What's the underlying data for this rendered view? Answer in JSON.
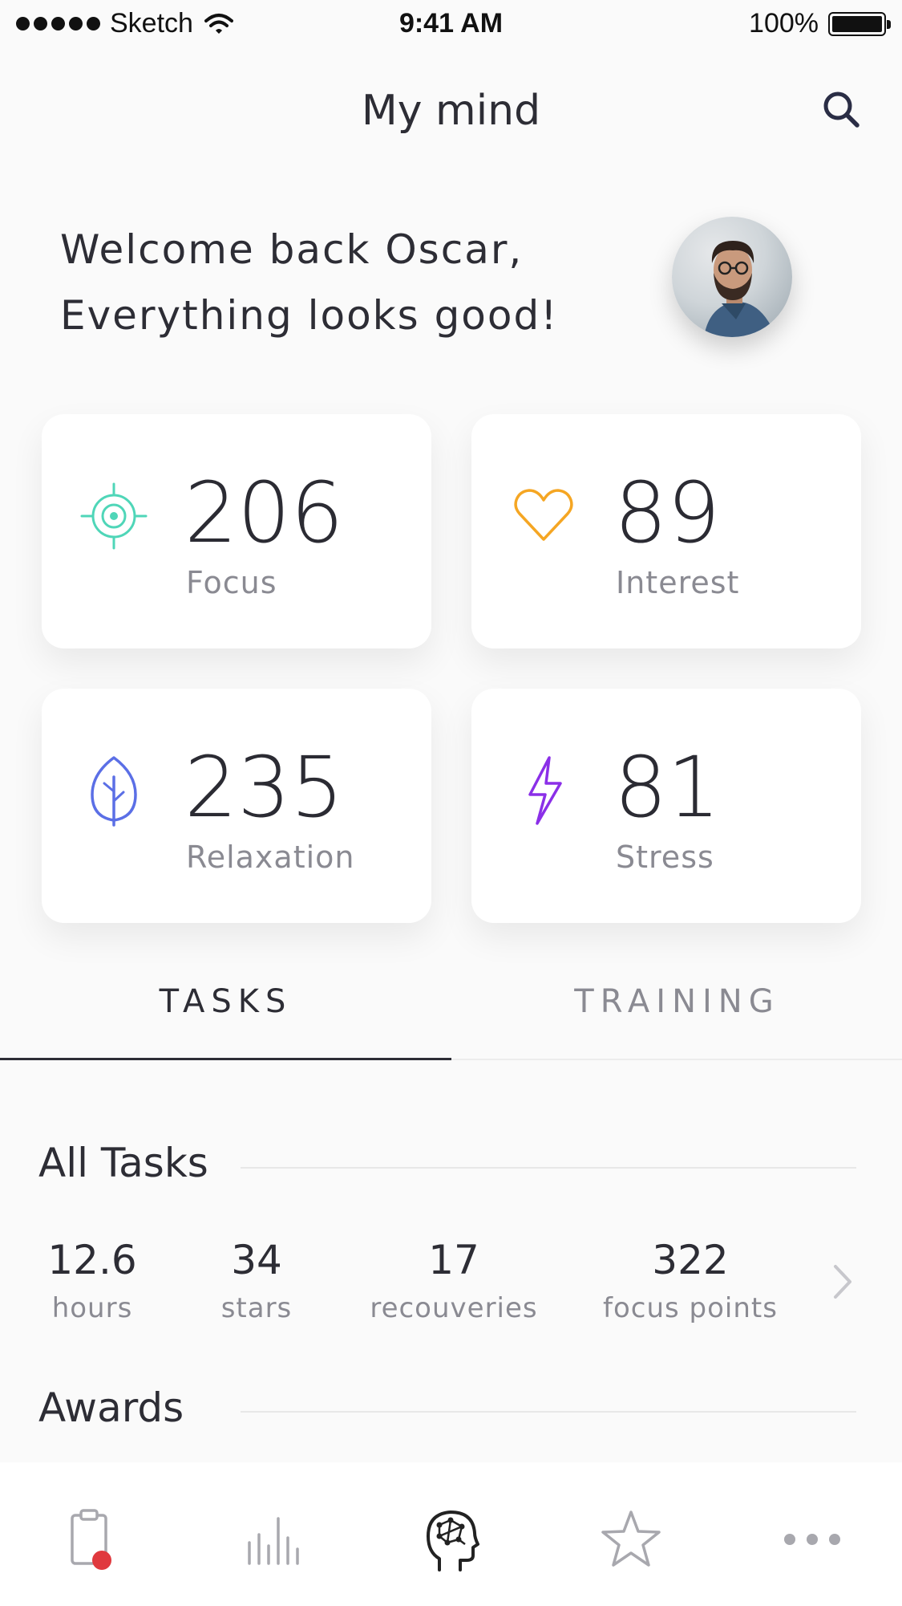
{
  "status_bar": {
    "carrier": "Sketch",
    "time": "9:41 AM",
    "battery": "100%"
  },
  "header": {
    "title": "My mind"
  },
  "welcome": {
    "line1": "Welcome back Oscar,",
    "line2": "Everything looks good!"
  },
  "metrics": [
    {
      "value": "206",
      "label": "Focus",
      "icon": "target-icon",
      "color": "#4fd6b8"
    },
    {
      "value": "89",
      "label": "Interest",
      "icon": "heart-icon",
      "color": "#f5a623"
    },
    {
      "value": "235",
      "label": "Relaxation",
      "icon": "leaf-icon",
      "color": "#5b6fe6"
    },
    {
      "value": "81",
      "label": "Stress",
      "icon": "lightning-icon",
      "color": "#8b2fe8"
    }
  ],
  "tabs": {
    "active": "TASKS",
    "inactive": "TRAINING"
  },
  "tasks": {
    "title": "All Tasks",
    "stats": [
      {
        "value": "12.6",
        "unit": "hours"
      },
      {
        "value": "34",
        "unit": "stars"
      },
      {
        "value": "17",
        "unit": "recouveries"
      },
      {
        "value": "322",
        "unit": "focus points"
      }
    ]
  },
  "awards": {
    "title": "Awards"
  },
  "tabbar": {
    "items": [
      "clipboard-icon",
      "chart-bars-icon",
      "brain-head-icon",
      "star-icon",
      "more-icon"
    ],
    "active": "brain-head-icon",
    "badge_color": "#e0393e"
  }
}
